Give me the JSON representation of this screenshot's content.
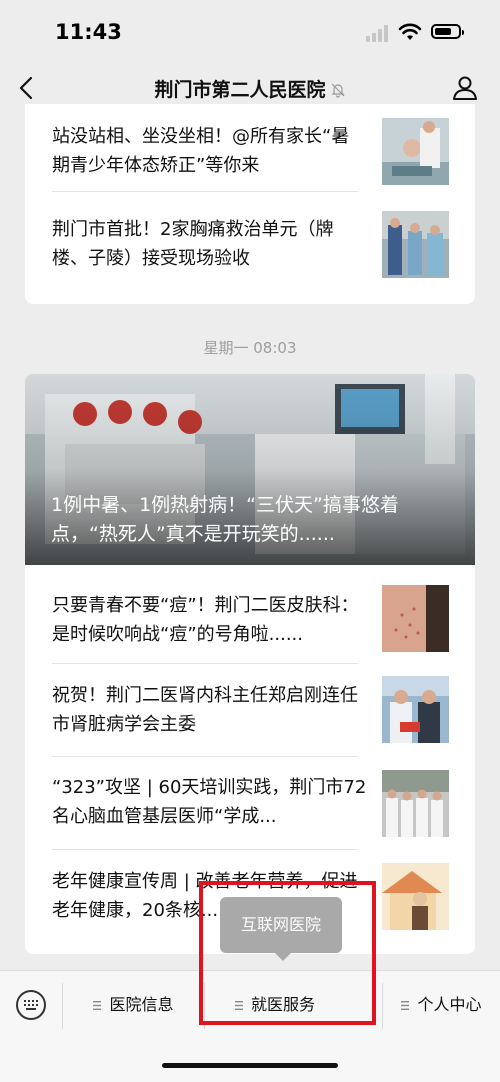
{
  "status_bar": {
    "time": "11:43"
  },
  "nav": {
    "title": "荆门市第二人民医院"
  },
  "card1": {
    "items": [
      {
        "title": "站没站相、坐没坐相！@所有家长“暑期青少年体态矫正”等你来"
      },
      {
        "title": "荆门市首批！2家胸痛救治单元（牌楼、子陵）接受现场验收"
      }
    ]
  },
  "timestamp": "星期一 08:03",
  "card2": {
    "hero_title": "1例中暑、1例热射病！“三伏天”搞事悠着点，“热死人”真不是开玩笑的......",
    "items": [
      {
        "title": "只要青春不要“痘”！荆门二医皮肤科：是时候吹响战“痘”的号角啦......"
      },
      {
        "title": "祝贺！荆门二医肾内科主任郑启刚连任市肾脏病学会主委"
      },
      {
        "title": "“323”攻坚 | 60天培训实践，荆门市72名心脑血管基层医师“学成..."
      },
      {
        "title": "老年健康宣传周 | 改善老年营养，促进老年健康，20条核..."
      }
    ]
  },
  "tooltip": {
    "label": "互联网医院"
  },
  "menu": {
    "items": [
      {
        "label": "医院信息"
      },
      {
        "label": "就医服务"
      },
      {
        "label": "个人中心"
      }
    ]
  },
  "colors": {
    "highlight": "#e0141e",
    "tooltip": "#a9a9a9",
    "background": "#ededed"
  },
  "icons": [
    "back-arrow-icon",
    "bell-muted-icon",
    "profile-icon",
    "keyboard-icon",
    "menu-list-icon"
  ]
}
